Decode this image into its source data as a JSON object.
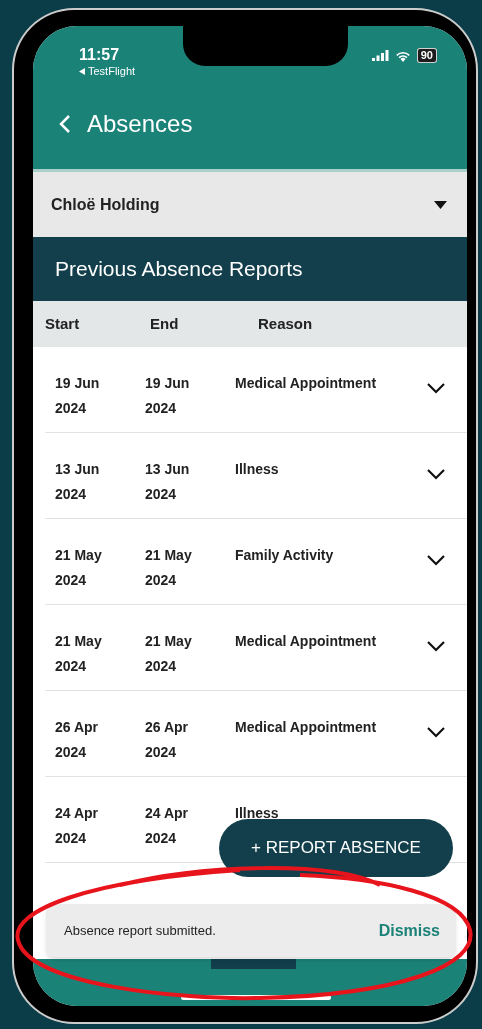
{
  "status_bar": {
    "time": "11:57",
    "back_app": "TestFlight",
    "battery": "90"
  },
  "header": {
    "title": "Absences"
  },
  "student_picker": {
    "value": "Chloë Holding"
  },
  "section_title": "Previous Absence Reports",
  "table": {
    "columns": [
      "Start",
      "End",
      "Reason"
    ],
    "rows": [
      {
        "start": "19 Jun 2024",
        "end": "19 Jun 2024",
        "reason": "Medical Appointment",
        "expanded": false
      },
      {
        "start": "13 Jun 2024",
        "end": "13 Jun 2024",
        "reason": "Illness",
        "expanded": false
      },
      {
        "start": "21 May 2024",
        "end": "21 May 2024",
        "reason": "Family Activity",
        "expanded": false
      },
      {
        "start": "21 May 2024",
        "end": "21 May 2024",
        "reason": "Medical Appointment",
        "expanded": false
      },
      {
        "start": "26 Apr 2024",
        "end": "26 Apr 2024",
        "reason": "Medical Appointment",
        "expanded": false
      },
      {
        "start": "24 Apr 2024",
        "end": "24 Apr 2024",
        "reason": "Illness"
      }
    ]
  },
  "fab": {
    "label": "+ REPORT ABSENCE"
  },
  "toast": {
    "message": "Absence report submitted.",
    "action": "Dismiss"
  },
  "annotation": {
    "kind": "ellipse"
  }
}
